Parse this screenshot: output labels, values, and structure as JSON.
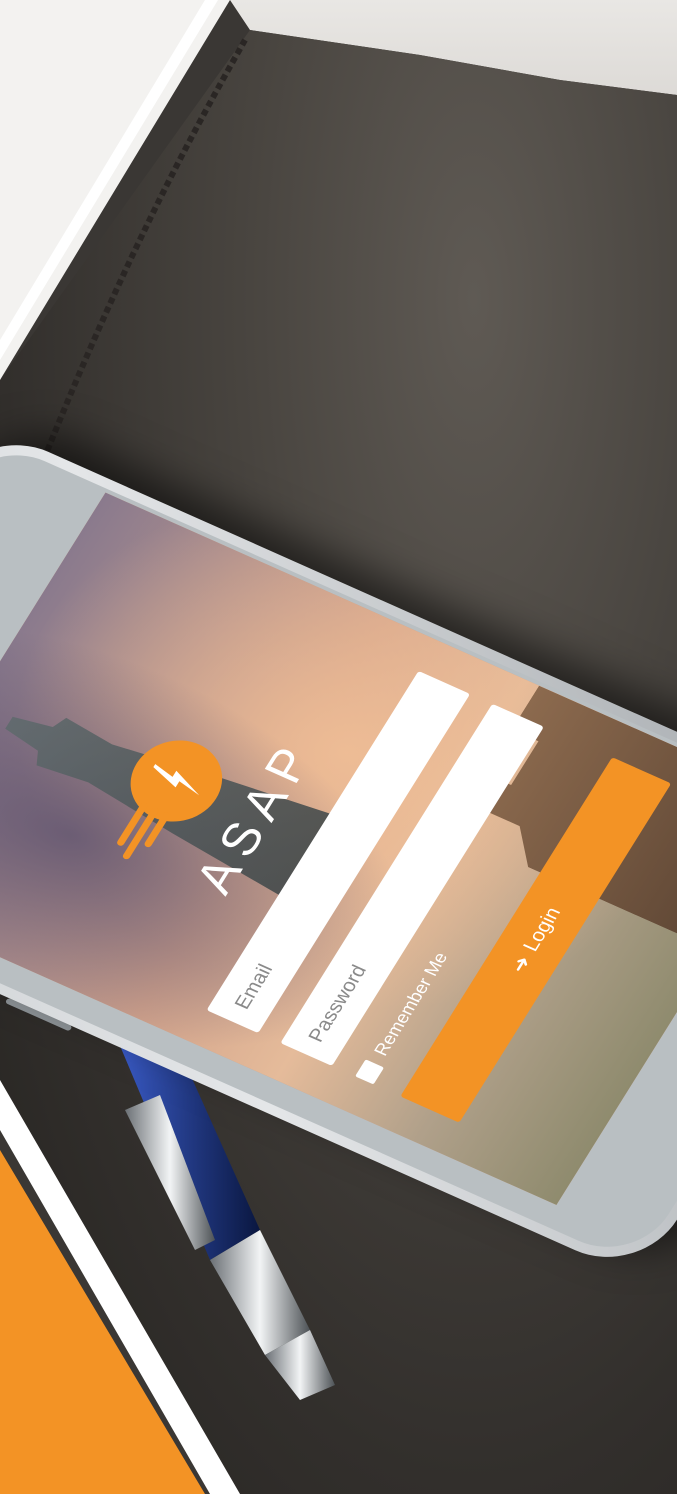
{
  "app": {
    "brand_name": "ASAP",
    "accent_color": "#f39325"
  },
  "login_form": {
    "email_placeholder": "Email",
    "password_placeholder": "Password",
    "remember_label": "Remember Me",
    "remember_checked": false,
    "login_label": "Login",
    "login_icon": "sign-in-icon"
  }
}
